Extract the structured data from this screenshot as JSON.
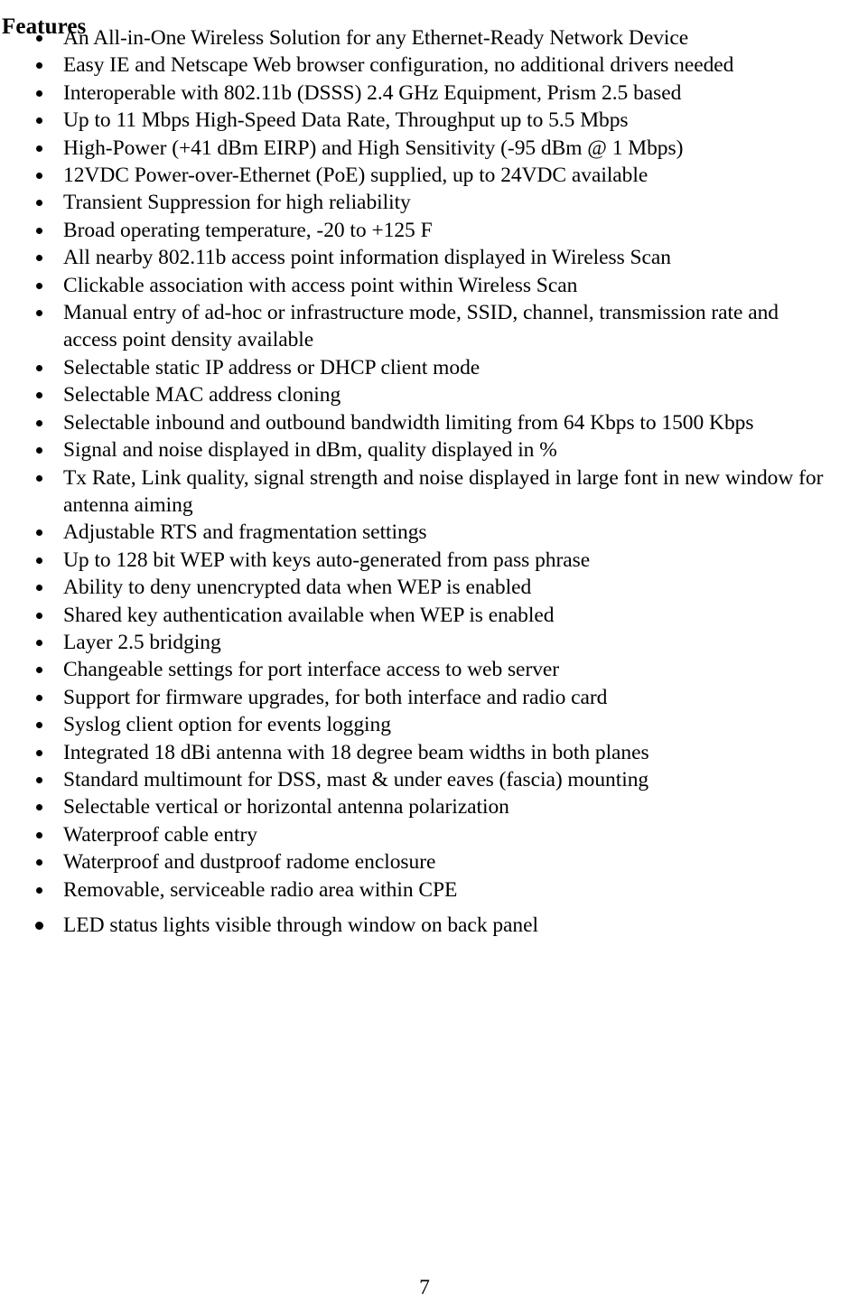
{
  "document": {
    "heading": "Features",
    "page_number": "7",
    "text_color": "#000000",
    "background_color": "#ffffff",
    "features": [
      {
        "text": "An All-in-One Wireless Solution for any Ethernet-Ready Network Device"
      },
      {
        "text": "Easy IE and Netscape Web browser configuration, no additional drivers needed"
      },
      {
        "text": "Interoperable with 802.11b (DSSS) 2.4 GHz Equipment, Prism 2.5 based"
      },
      {
        "text": "Up to 11 Mbps High-Speed Data Rate, Throughput up to 5.5 Mbps"
      },
      {
        "text": "High-Power (+41 dBm EIRP) and High Sensitivity (-95 dBm @ 1 Mbps)"
      },
      {
        "text": "12VDC Power-over-Ethernet (PoE) supplied, up to 24VDC available"
      },
      {
        "text": "Transient Suppression for high reliability"
      },
      {
        "text": "Broad operating temperature, -20 to +125 F"
      },
      {
        "text": "All nearby 802.11b access point information displayed in Wireless Scan"
      },
      {
        "text": "Clickable association with access point within Wireless Scan"
      },
      {
        "text": "Manual entry of ad-hoc or infrastructure mode, SSID, channel, transmission rate and access point density available"
      },
      {
        "text": "Selectable static IP address or DHCP client mode"
      },
      {
        "text": "Selectable MAC address cloning"
      },
      {
        "text": "Selectable inbound and outbound bandwidth limiting from 64 Kbps to 1500 Kbps"
      },
      {
        "text": "Signal and noise displayed in dBm, quality displayed in %"
      },
      {
        "text": "Tx Rate, Link quality, signal strength and noise displayed in large font in new window for antenna aiming"
      },
      {
        "text": "Adjustable RTS and fragmentation settings"
      },
      {
        "text": "Up to 128 bit WEP with keys auto-generated from pass phrase"
      },
      {
        "text": "Ability to deny unencrypted data when WEP is enabled"
      },
      {
        "text": "Shared key authentication available when WEP is enabled"
      },
      {
        "text": "Layer 2.5 bridging"
      },
      {
        "text": "Changeable settings for port interface access to web server"
      },
      {
        "text": "Support for firmware upgrades, for both interface and radio card"
      },
      {
        "text": "Syslog client option for events logging"
      },
      {
        "text": "Integrated 18 dBi antenna with 18 degree beam widths in both planes"
      },
      {
        "text": "Standard multimount for DSS, mast & under eaves (fascia) mounting"
      },
      {
        "text": "Selectable vertical or horizontal antenna polarization"
      },
      {
        "text": "Waterproof cable entry"
      },
      {
        "text": "Waterproof and dustproof radome enclosure"
      },
      {
        "text": "Removable, serviceable radio area within CPE"
      },
      {
        "text": "LED status lights visible through window on back panel"
      }
    ]
  }
}
